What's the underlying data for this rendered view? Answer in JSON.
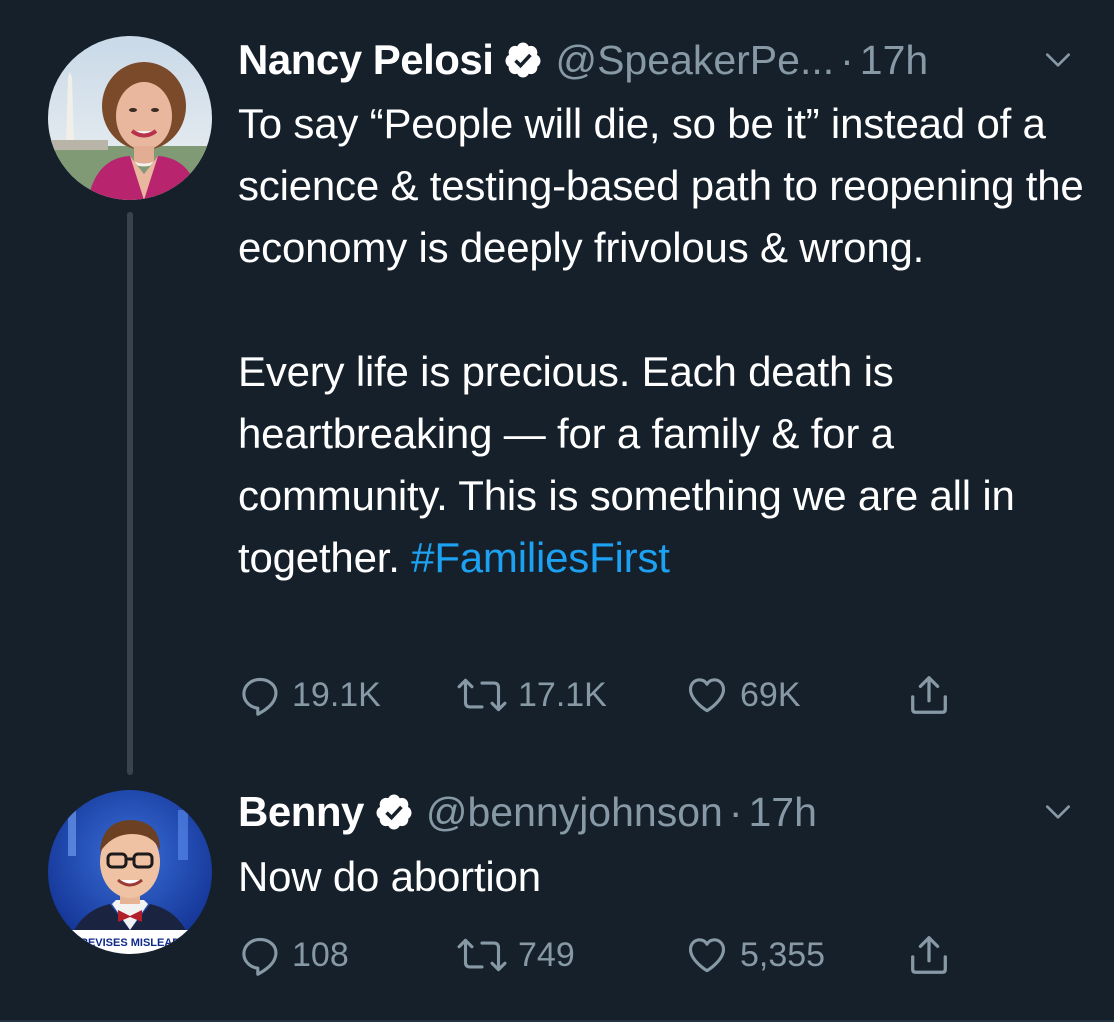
{
  "tweets": [
    {
      "display_name": "Nancy Pelosi",
      "verified": true,
      "handle": "@SpeakerPe...",
      "separator": "·",
      "time": "17h",
      "text_paragraphs": [
        "To say “People will die, so be it” instead of a science & testing-based path to reopening the economy is deeply frivolous & wrong.",
        "Every life is precious. Each death is heartbreaking — for a family & for a community. This is something we are all in together."
      ],
      "hashtag": "#FamiliesFirst",
      "replies": "19.1K",
      "retweets": "17.1K",
      "likes": "69K"
    },
    {
      "display_name": "Benny",
      "verified": true,
      "handle": "@bennyjohnson",
      "separator": "·",
      "time": "17h",
      "text": "Now do abortion",
      "avatar_caption": "REVISES MISLEADING ... NATION FO",
      "replies": "108",
      "retweets": "749",
      "likes": "5,355"
    }
  ],
  "colors": {
    "background": "#15202b",
    "primary_text": "#ffffff",
    "secondary_text": "#8899a6",
    "link": "#1da1f2",
    "thread_line": "#38444d"
  },
  "icons": [
    "verified-badge-icon",
    "chevron-down-icon",
    "reply-icon",
    "retweet-icon",
    "like-icon",
    "share-icon"
  ]
}
